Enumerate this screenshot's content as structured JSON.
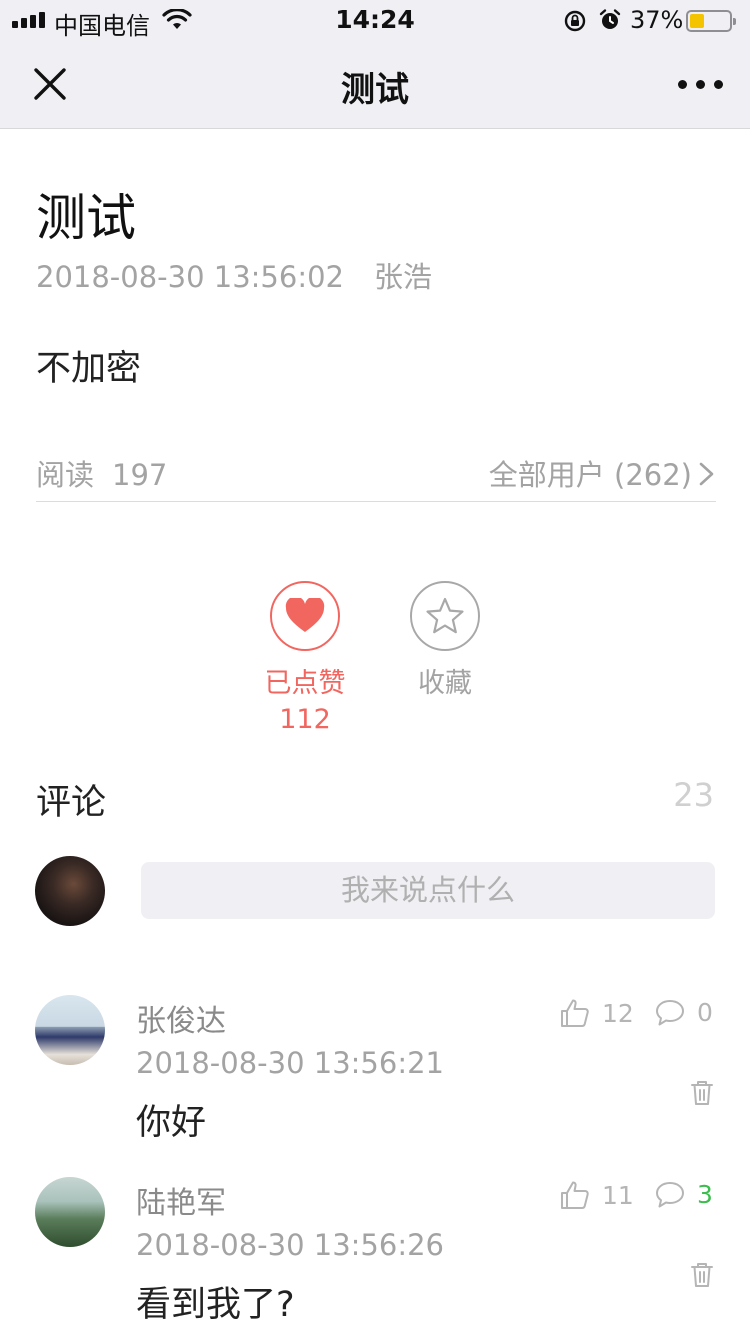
{
  "status_bar": {
    "carrier": "中国电信",
    "time": "14:24",
    "battery_percent": "37%",
    "battery_level": 0.37,
    "icons": [
      "signal-icon",
      "wifi-icon",
      "rotation-lock-icon",
      "alarm-icon",
      "battery-icon"
    ]
  },
  "nav": {
    "title": "测试",
    "close_icon": "close-icon",
    "more_icon": "more-icon"
  },
  "article": {
    "title": "测试",
    "datetime": "2018-08-30 13:56:02",
    "author": "张浩",
    "body": "不加密",
    "read_label": "阅读",
    "read_count": "197",
    "audience_label": "全部用户 (262)"
  },
  "actions": {
    "like_label": "已点赞",
    "like_count": "112",
    "favorite_label": "收藏",
    "like_color": "#f26660"
  },
  "comments": {
    "title": "评论",
    "count": "23",
    "input_placeholder": "我来说点什么",
    "items": [
      {
        "name": "张俊达",
        "time": "2018-08-30 13:56:21",
        "text": "你好",
        "likes": "12",
        "replies": "0"
      },
      {
        "name": "陆艳军",
        "time": "2018-08-30 13:56:26",
        "text": "看到我了?",
        "likes": "11",
        "replies": "3"
      }
    ]
  }
}
